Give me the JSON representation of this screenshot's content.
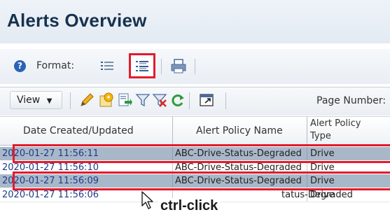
{
  "page": {
    "title": "Alerts Overview"
  },
  "toolbar": {
    "help_icon": "help-icon",
    "format_label": "Format:",
    "list_view_icon": "list-view-icon",
    "detail_view_icon": "detail-view-icon",
    "print_icon": "print-icon",
    "highlight_color": "#e31b2b"
  },
  "actions": {
    "view_label": "View",
    "icons": [
      "edit-pencil-icon",
      "new-alert-icon",
      "export-icon",
      "filter-icon",
      "clear-filter-icon",
      "refresh-icon",
      "detach-icon"
    ],
    "page_number_label": "Page Number:"
  },
  "table": {
    "columns": [
      "Date Created/Updated",
      "Alert Policy Name",
      "Alert Policy",
      "Type"
    ],
    "rows": [
      {
        "date": "2020-01-27 11:56:11",
        "policy": "ABC-Drive-Status-Degraded",
        "type": "Drive",
        "selected": true
      },
      {
        "date": "2020-01-27 11:56:10",
        "policy": "ABC-Drive-Status-Degraded",
        "type": "Drive",
        "selected": false
      },
      {
        "date": "2020-01-27 11:56:09",
        "policy": "ABC-Drive-Status-Degraded",
        "type": "Drive",
        "selected": true
      },
      {
        "date": "2020-01-27 11:56:06",
        "policy": "tatus-Degraded",
        "type": "Drive",
        "selected": false
      }
    ],
    "selected_color": "#a9b8c9"
  },
  "annotation": {
    "text": "ctrl-click"
  }
}
